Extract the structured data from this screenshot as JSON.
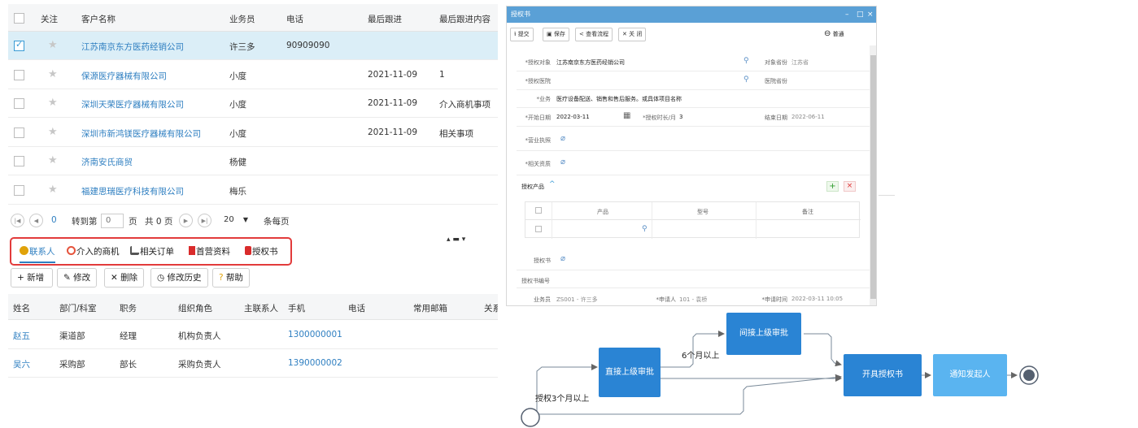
{
  "customers": {
    "headers": [
      "关注",
      "客户名称",
      "业务员",
      "电话",
      "最后跟进",
      "最后跟进内容"
    ],
    "rows": [
      {
        "name": "江苏南京东方医药经销公司",
        "sales": "许三多",
        "phone": "90909090",
        "date": "",
        "content": "",
        "selected": true
      },
      {
        "name": "保源医疗器械有限公司",
        "sales": "小度",
        "phone": "",
        "date": "2021-11-09",
        "content": "1",
        "selected": false
      },
      {
        "name": "深圳天荣医疗器械有限公司",
        "sales": "小度",
        "phone": "",
        "date": "2021-11-09",
        "content": "介入商机事项",
        "selected": false
      },
      {
        "name": "深圳市新鸿镁医疗器械有限公司",
        "sales": "小度",
        "phone": "",
        "date": "2021-11-09",
        "content": "相关事项",
        "selected": false
      },
      {
        "name": "济南安氏商贸",
        "sales": "杨健",
        "phone": "",
        "date": "",
        "content": "",
        "selected": false
      },
      {
        "name": "福建思瑞医疗科技有限公司",
        "sales": "梅乐",
        "phone": "",
        "date": "",
        "content": "",
        "selected": false
      }
    ]
  },
  "pager": {
    "current": "0",
    "goto_label": "转到第",
    "goto_value": "0",
    "page_label": "页",
    "total": "共 0 页",
    "page_size": "20",
    "per_page_label": "条每页"
  },
  "tabs": [
    {
      "label": "联系人",
      "icon": "person-icon",
      "color": "#e0a20a",
      "active": true
    },
    {
      "label": "介入的商机",
      "icon": "target-icon",
      "color": "#e5533c",
      "active": false
    },
    {
      "label": "相关订单",
      "icon": "cart-icon",
      "color": "#555555",
      "active": false
    },
    {
      "label": "首营资料",
      "icon": "flag-icon",
      "color": "#d92b2b",
      "active": false
    },
    {
      "label": "授权书",
      "icon": "book-icon",
      "color": "#d92b2b",
      "active": false
    }
  ],
  "toolbar": {
    "add": "+ 新增",
    "edit": "修改",
    "delete": "删除",
    "history": "修改历史",
    "help": "帮助"
  },
  "contacts": {
    "headers": [
      "姓名",
      "部门/科室",
      "职务",
      "组织角色",
      "主联系人",
      "手机",
      "电话",
      "常用邮箱",
      "关系"
    ],
    "rows": [
      {
        "name": "赵五",
        "dept": "渠道部",
        "title": "经理",
        "role": "机构负责人",
        "mobile": "1300000001"
      },
      {
        "name": "吴六",
        "dept": "采购部",
        "title": "部长",
        "role": "采购负责人",
        "mobile": "1390000002"
      }
    ]
  },
  "dialog": {
    "title": "授权书",
    "buttons": {
      "submit": "提交",
      "save": "保存",
      "view_flow": "查看流程",
      "close": "关 闭"
    },
    "mode": "普通",
    "fields": {
      "target_label": "*授权对象",
      "target_value": "江苏南京东方医药经销公司",
      "obj_province_label": "对象省份",
      "obj_province_value": "江苏省",
      "hospital_label": "*授权医院",
      "hospital_province_label": "医院省份",
      "business_label": "*业务",
      "business_value": "医疗设备配送、销售和售后服务。或具体项目名称",
      "start_label": "*开始日期",
      "start_value": "2022-03-11",
      "months_label": "*授权时长/月",
      "months_value": "3",
      "end_label": "结束日期",
      "end_value": "2022-06-11",
      "license_label": "*营业执照",
      "qual_label": "*相关资质",
      "products_label": "授权产品",
      "prod_headers": [
        "产品",
        "型号",
        "备注"
      ],
      "letter_label": "授权书",
      "letter_no_label": "授权书编号",
      "salesman_label": "业务员",
      "salesman_value": "ZS001 - 许三多",
      "applicant_label": "*申请人",
      "applicant_value": "101 - 袁桥",
      "apply_time_label": "*申请时间",
      "apply_time_value": "2022-03-11 10:05"
    }
  },
  "flow": {
    "direct": "直接上级审批",
    "indirect": "间接上级审批",
    "issue": "开具授权书",
    "notify": "通知发起人",
    "label_6m": "6个月以上",
    "label_3m": "授权3个月以上"
  }
}
